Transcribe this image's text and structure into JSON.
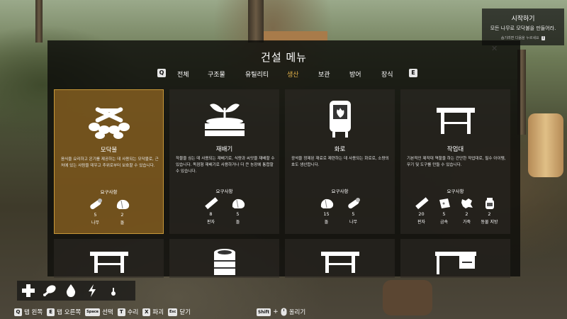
{
  "objective": {
    "title": "시작하기",
    "text": "모든 나무로 모닥불을 만들어라.",
    "hint": "숨기려면 다음을 누르세요",
    "hint_key": "I",
    "close": "✕"
  },
  "menu": {
    "title": "건설 메뉴",
    "prev_key": "Q",
    "next_key": "E",
    "tabs": [
      {
        "label": "전체",
        "active": false
      },
      {
        "label": "구조물",
        "active": false
      },
      {
        "label": "유틸리티",
        "active": false
      },
      {
        "label": "생산",
        "active": true
      },
      {
        "label": "보관",
        "active": false
      },
      {
        "label": "방어",
        "active": false
      },
      {
        "label": "장식",
        "active": false
      }
    ],
    "requirements_label": "요구사항"
  },
  "cards": [
    {
      "name": "모닥불",
      "icon": "campfire-icon",
      "selected": true,
      "description": "음식을 요리하고 온기를 제공하는 데 사용되는 모닥불로, 근처에 있는 사람을 데우고 추위로부터 보호할 수 있습니다.",
      "requirements": [
        {
          "icon": "log-icon",
          "qty": "5",
          "name": "나무"
        },
        {
          "icon": "stone-icon",
          "qty": "2",
          "name": "돌"
        }
      ]
    },
    {
      "name": "재배기",
      "icon": "planter-icon",
      "selected": false,
      "description": "작물을 심는 데 사용되는 재배기로, 식량과 씨앗을 재배할 수 있습니다. 독점형 재배기로 사용하거나 더 큰 농장에 통합할 수 있습니다.",
      "requirements": [
        {
          "icon": "plank-icon",
          "qty": "8",
          "name": "판자"
        },
        {
          "icon": "stone-icon",
          "qty": "5",
          "name": "돌"
        }
      ]
    },
    {
      "name": "화로",
      "icon": "furnace-icon",
      "selected": false,
      "description": "광석을 정제된 재료로 제련하는 데 사용되는 화로로, 소량의 호도 생산합니다.",
      "requirements": [
        {
          "icon": "stone-icon",
          "qty": "15",
          "name": "돌"
        },
        {
          "icon": "log-icon",
          "qty": "5",
          "name": "나무"
        }
      ]
    },
    {
      "name": "작업대",
      "icon": "workbench-icon",
      "selected": false,
      "description": "기본적인 제작대 역할을 하는 간단한 작업대로, 필수 아이템, 무기 및 도구를 만들 수 있습니다.",
      "requirements": [
        {
          "icon": "plank-icon",
          "qty": "20",
          "name": "판자"
        },
        {
          "icon": "metal-icon",
          "qty": "5",
          "name": "금속"
        },
        {
          "icon": "leather-icon",
          "qty": "2",
          "name": "가죽"
        },
        {
          "icon": "jar-icon",
          "qty": "2",
          "name": "동물 지방"
        }
      ]
    }
  ],
  "partial_cards": [
    {
      "icon": "table-icon"
    },
    {
      "icon": "barrel-icon"
    },
    {
      "icon": "table-icon"
    },
    {
      "icon": "desk-icon"
    }
  ],
  "status_icons": [
    "health-plus-icon",
    "hunger-drumstick-icon",
    "thirst-drop-icon",
    "energy-bolt-icon",
    "temperature-icon"
  ],
  "controls": [
    {
      "key": "Q",
      "label": "탭 왼쪽"
    },
    {
      "key": "E",
      "label": "탭 오른쪽"
    },
    {
      "key": "Space",
      "label": "선택"
    },
    {
      "key": "T",
      "label": "수리"
    },
    {
      "key": "X",
      "label": "파괴"
    },
    {
      "key": "Esc",
      "label": "닫기"
    }
  ],
  "climb": {
    "key": "Shift",
    "plus": "+",
    "label": "올리기"
  }
}
